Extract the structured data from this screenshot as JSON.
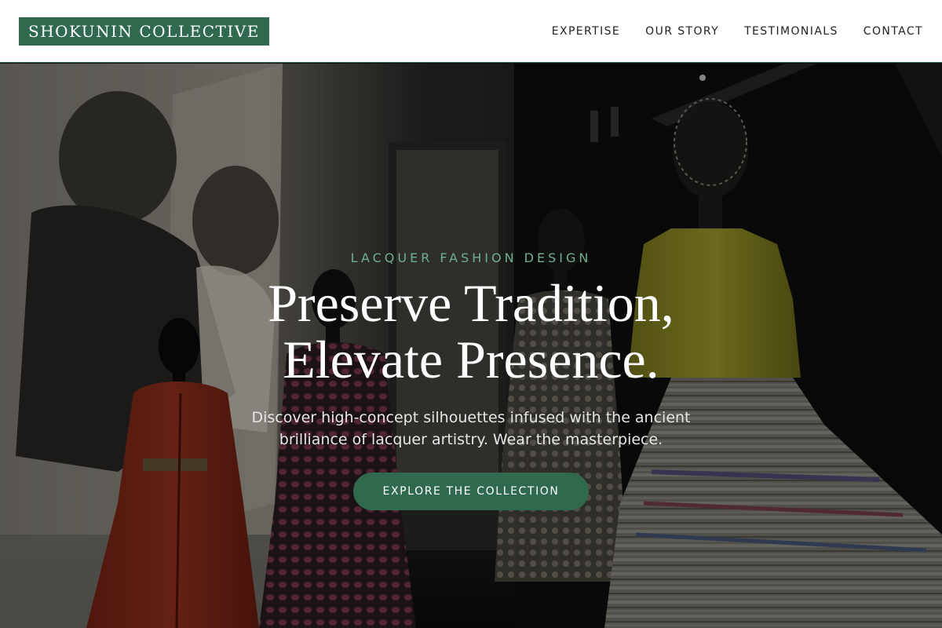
{
  "header": {
    "logo": "SHOKUNIN COLLECTIVE",
    "nav": [
      {
        "label": "EXPERTISE"
      },
      {
        "label": "OUR STORY"
      },
      {
        "label": "TESTIMONIALS"
      },
      {
        "label": "CONTACT"
      }
    ]
  },
  "hero": {
    "eyebrow": "LACQUER FASHION DESIGN",
    "headline_line1": "Preserve Tradition,",
    "headline_line2": "Elevate Presence.",
    "subtext": "Discover high-concept silhouettes infused with the ancient brilliance of lacquer artistry. Wear the masterpiece.",
    "cta_label": "EXPLORE THE COLLECTION",
    "background_image": "fashion-exhibition-mannequins-photo"
  },
  "colors": {
    "brand_green": "#2f6a4f",
    "eyebrow_green": "#6fb08d",
    "header_bg": "#ffffff",
    "text_dark": "#222222"
  }
}
